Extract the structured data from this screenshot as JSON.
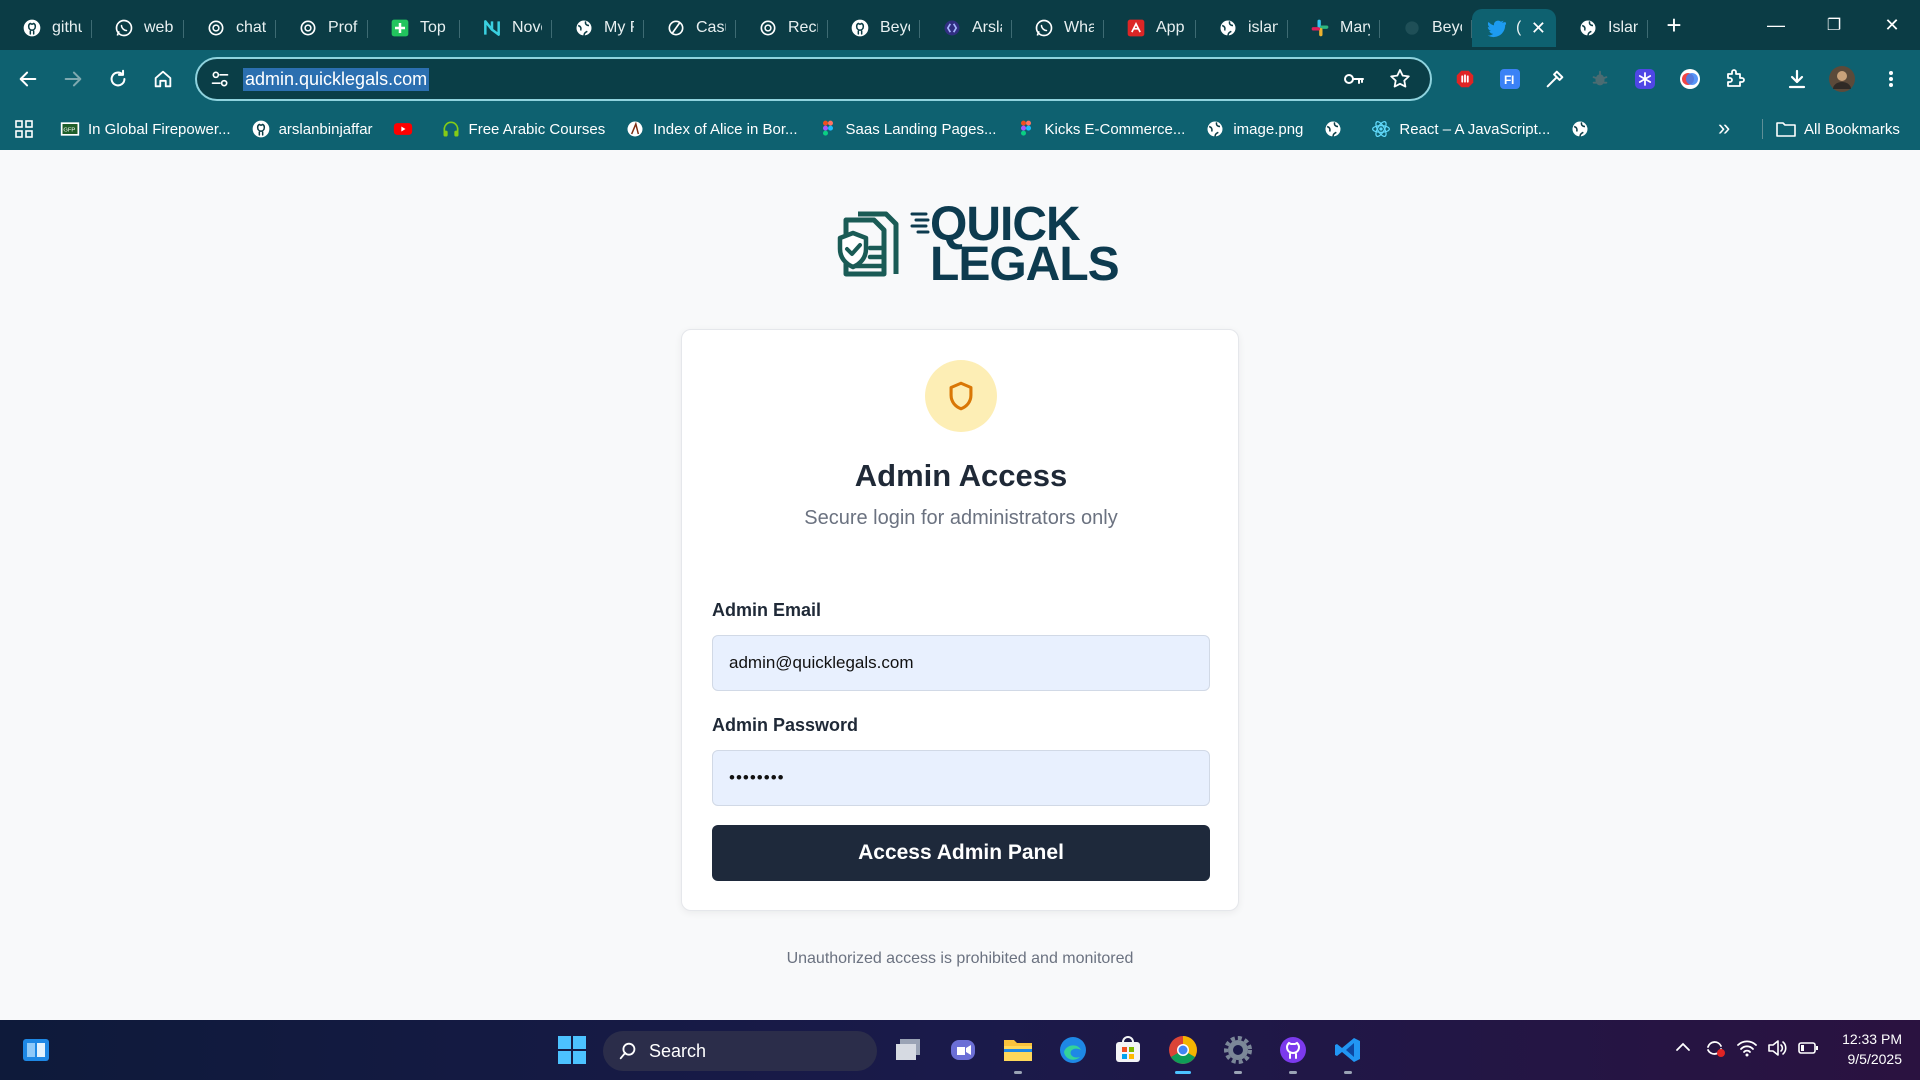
{
  "browser": {
    "tabs": [
      {
        "label": "githu",
        "icon": "github-icon"
      },
      {
        "label": "web.",
        "icon": "whatsapp-icon"
      },
      {
        "label": "chat",
        "icon": "openai-icon"
      },
      {
        "label": "Profe",
        "icon": "openai-icon"
      },
      {
        "label": "Top S",
        "icon": "plus-square-icon"
      },
      {
        "label": "Novo",
        "icon": "n-logo-icon"
      },
      {
        "label": "My R",
        "icon": "globe-icon"
      },
      {
        "label": "Casu",
        "icon": "slash-circle-icon"
      },
      {
        "label": "Recru",
        "icon": "openai-icon"
      },
      {
        "label": "Beyo",
        "icon": "github-icon"
      },
      {
        "label": "Arsla",
        "icon": "bracket-icon"
      },
      {
        "label": "Wha",
        "icon": "whatsapp-icon"
      },
      {
        "label": "App",
        "icon": "app-icon"
      },
      {
        "label": "islan",
        "icon": "globe-icon"
      },
      {
        "label": "Mary",
        "icon": "slack-icon"
      },
      {
        "label": "Beyo",
        "icon": "blank-icon"
      }
    ],
    "active_tab": {
      "label": "(",
      "icon": "bird-icon",
      "close": "✕"
    },
    "last_tab": {
      "label": "Islan",
      "icon": "globe-icon"
    },
    "new_tab": "+",
    "window_controls": {
      "minimize": "—",
      "restore": "❐",
      "close": "✕"
    },
    "url": "admin.quicklegals.com",
    "bookmarks": [
      {
        "label": "In Global Firepower...",
        "icon": "gfp-icon"
      },
      {
        "label": "arslanbinjaffar",
        "icon": "github-icon"
      },
      {
        "label": "",
        "icon": "youtube-icon"
      },
      {
        "label": "Free Arabic Courses",
        "icon": "headphones-icon"
      },
      {
        "label": "Index of Alice in Bor...",
        "icon": "archive-icon"
      },
      {
        "label": "Saas Landing Pages...",
        "icon": "figma-icon"
      },
      {
        "label": "Kicks E-Commerce...",
        "icon": "figma-icon"
      },
      {
        "label": "image.png",
        "icon": "globe-icon"
      },
      {
        "label": "",
        "icon": "globe-icon"
      },
      {
        "label": "React – A JavaScript...",
        "icon": "react-icon"
      },
      {
        "label": "",
        "icon": "globe-icon"
      }
    ],
    "bookmarks_overflow": "»",
    "all_bookmarks": "All Bookmarks"
  },
  "page": {
    "logo": {
      "line1": "QUICK",
      "line2": "LEGALS"
    },
    "title": "Admin Access",
    "subtitle": "Secure login for administrators only",
    "email_label": "Admin Email",
    "email_value": "admin@quicklegals.com",
    "password_label": "Admin Password",
    "password_value": "••••••••",
    "submit_label": "Access Admin Panel",
    "footnote": "Unauthorized access is prohibited and monitored",
    "accent": "#1e293b",
    "shield_color": "#d97706"
  },
  "taskbar": {
    "search_label": "Search",
    "time": "12:33 PM",
    "date": "9/5/2025"
  }
}
